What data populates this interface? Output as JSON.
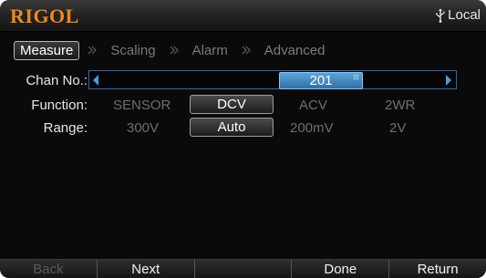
{
  "header": {
    "logo": "RIGOL",
    "status_text": "Local",
    "status_icon": "usb-icon",
    "logo_color": "#e8891f"
  },
  "tabs": [
    {
      "label": "Measure",
      "active": true
    },
    {
      "label": "Scaling",
      "active": false
    },
    {
      "label": "Alarm",
      "active": false
    },
    {
      "label": "Advanced",
      "active": false
    }
  ],
  "channel": {
    "label": "Chan No.:",
    "value": "201",
    "accent_color": "#2e6fa8"
  },
  "function": {
    "label": "Function:",
    "options": [
      "SENSOR",
      "DCV",
      "ACV",
      "2WR"
    ],
    "selected": "DCV"
  },
  "range": {
    "label": "Range:",
    "options": [
      "300V",
      "Auto",
      "200mV",
      "2V"
    ],
    "selected": "Auto"
  },
  "softkeys": [
    {
      "label": "Back",
      "enabled": false
    },
    {
      "label": "Next",
      "enabled": true
    },
    {
      "label": "",
      "enabled": false
    },
    {
      "label": "Done",
      "enabled": true
    },
    {
      "label": "Return",
      "enabled": true
    }
  ]
}
